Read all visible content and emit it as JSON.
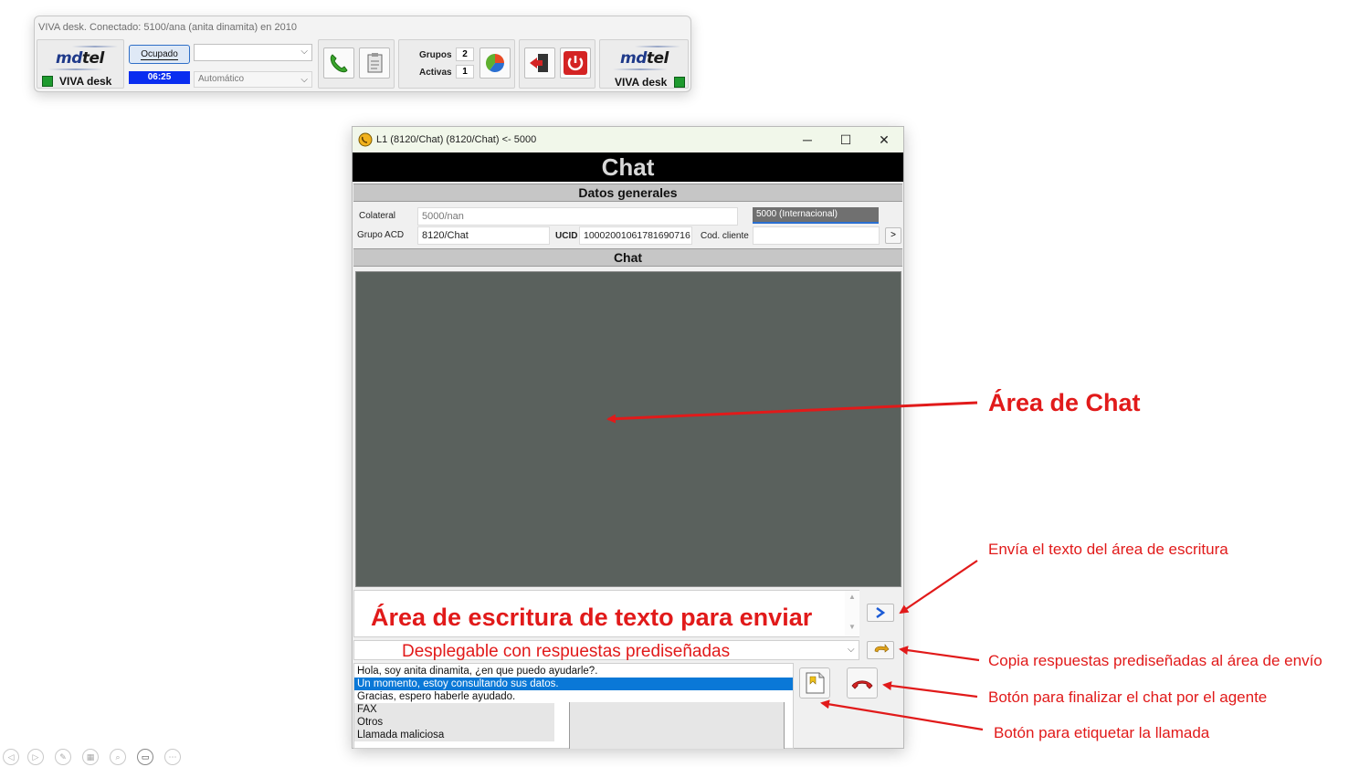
{
  "toolbar": {
    "title": "VIVA desk. Conectado: 5100/ana (anita dinamita) en 2010",
    "logo_left": {
      "md": "md",
      "tel": "tel"
    },
    "viva_left": "VIVA desk",
    "status_button": "Ocupado",
    "timer": "06:25",
    "mode_select": "Automático",
    "grupos_label": "Grupos",
    "grupos_count": "2",
    "activas_label": "Activas",
    "activas_count": "1",
    "logo_right": {
      "md": "md",
      "tel": "tel"
    },
    "viva_right": "VIVA desk",
    "status_color": "#1e9a2e",
    "timer_color": "#0a2df0"
  },
  "chat_window": {
    "title": "L1 (8120/Chat) (8120/Chat) <- 5000",
    "header": "Chat",
    "section_general": "Datos generales",
    "fields": {
      "colateral_label": "Colateral",
      "colateral_value": "5000/nan",
      "colateral_extra": "5000 (Internacional)",
      "grupo_label": "Grupo ACD",
      "grupo_value": "8120/Chat",
      "ucid_label": "UCID",
      "ucid_value": "10002001061781690716",
      "cod_label": "Cod. cliente",
      "cod_value": "",
      "more_button": ">"
    },
    "section_chat": "Chat",
    "write_area_text": "Área de escritura de texto para enviar",
    "dropdown_text": "Desplegable con respuestas prediseñadas",
    "responses": [
      "Hola, soy anita dinamita, ¿en que puedo ayudarle?.",
      "Un momento, estoy consultando sus datos.",
      "Gracias, espero haberle ayudado."
    ],
    "tags": [
      "FAX",
      "Otros",
      "Llamada maliciosa"
    ],
    "selected_response_index": 1,
    "accent_color": "#0a78d7"
  },
  "annotations": {
    "chat_area": "Área de Chat",
    "send": "Envía el texto del área de escritura",
    "copy": "Copia respuestas prediseñadas al área de envío",
    "end_chat": "Botón para finalizar el chat por el agente",
    "tag_call": "Botón para etiquetar la llamada",
    "color": "#e11a1a"
  },
  "slide_controls": [
    "prev-icon",
    "next-icon",
    "pen-icon",
    "pages-icon",
    "zoom-icon",
    "camera-icon",
    "more-icon"
  ]
}
